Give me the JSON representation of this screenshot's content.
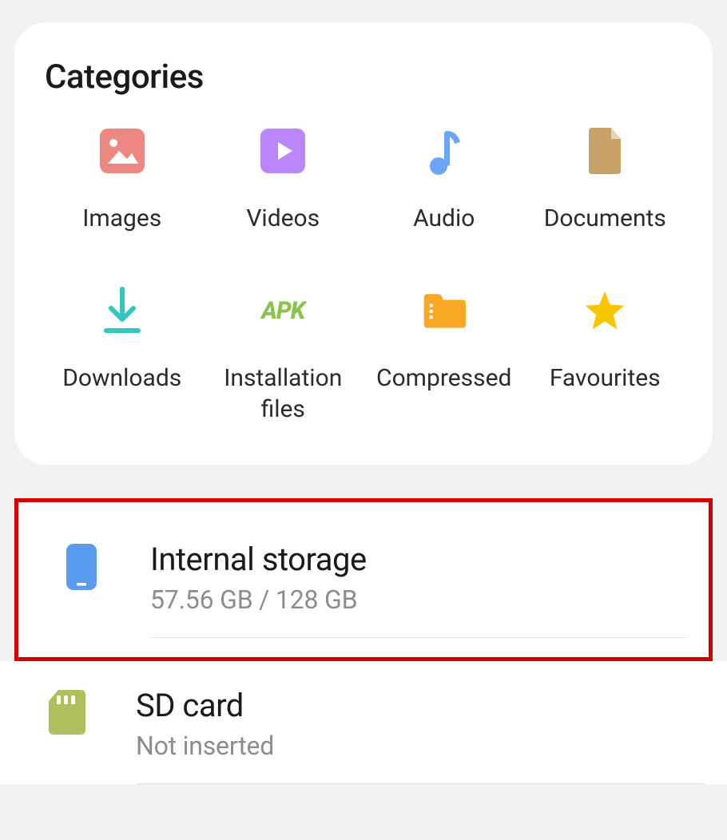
{
  "categories": {
    "title": "Categories",
    "items": [
      {
        "label": "Images"
      },
      {
        "label": "Videos"
      },
      {
        "label": "Audio"
      },
      {
        "label": "Documents"
      },
      {
        "label": "Downloads"
      },
      {
        "label": "Installation\nfiles"
      },
      {
        "label": "Compressed"
      },
      {
        "label": "Favourites"
      }
    ]
  },
  "storage": {
    "internal": {
      "title": "Internal storage",
      "usage": "57.56 GB / 128 GB"
    },
    "sdcard": {
      "title": "SD card",
      "status": "Not inserted"
    }
  }
}
